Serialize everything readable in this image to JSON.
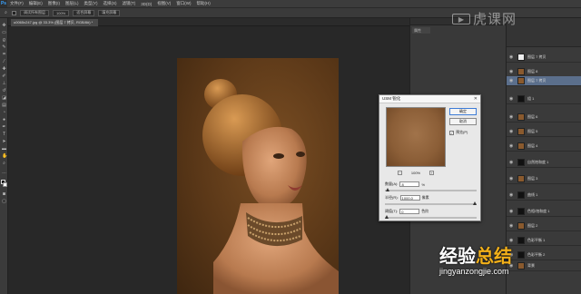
{
  "app": {
    "logo": "Ps"
  },
  "menubar": {
    "items": [
      "文件(F)",
      "编辑(E)",
      "图像(I)",
      "图层(L)",
      "类型(Y)",
      "选择(S)",
      "滤镜(T)",
      "3D(D)",
      "视图(V)",
      "窗口(W)",
      "帮助(H)"
    ]
  },
  "options": {
    "sample": "调试所有图层",
    "zoom": "100%",
    "fit_screen": "适合屏幕",
    "fill_screen": "填充屏幕"
  },
  "document": {
    "tab_label": "u0065x247.jpg @ 33.3% (图层 7 拷贝, RGB/8#) *"
  },
  "panels": {
    "strip_tab": "属性"
  },
  "layers": {
    "rows": [
      {
        "name": "图层 7 拷贝"
      },
      {
        "name": "图层 8"
      },
      {
        "name": "图层 7 拷贝"
      },
      {
        "name": "组 1"
      },
      {
        "name": "图层 6"
      },
      {
        "name": "图层 5"
      },
      {
        "name": "图层 4"
      },
      {
        "name": "自然饱和度 1"
      },
      {
        "name": "图层 3"
      },
      {
        "name": "曲线 1"
      },
      {
        "name": "色相/饱和度 1"
      },
      {
        "name": "图层 2"
      },
      {
        "name": "色彩平衡 1"
      },
      {
        "name": "色彩平衡 2"
      },
      {
        "name": "背景"
      }
    ]
  },
  "dialog": {
    "title": "USM 锐化",
    "ok": "确定",
    "cancel": "取消",
    "preview_label": "预览(P)",
    "zoom": "100%",
    "amount_label": "数量(A):",
    "amount_value": "8",
    "amount_unit": "%",
    "radius_label": "半径(R):",
    "radius_value": "1000.0",
    "radius_unit": "像素",
    "threshold_label": "阈值(T):",
    "threshold_value": "0",
    "threshold_unit": "色阶"
  },
  "watermarks": {
    "top": "虎课网",
    "bottom_main_1": "经验",
    "bottom_main_2": "总结",
    "bottom_url": "jingyanzongjie.com"
  },
  "colors": {
    "selection": "#5b6f8c",
    "accent": "#3aa3ff",
    "watermark_highlight": "#f2b019"
  }
}
